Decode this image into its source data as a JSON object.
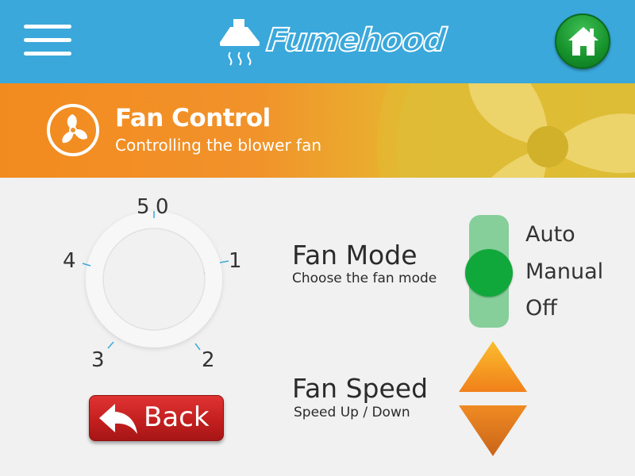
{
  "header": {
    "brand": "Fumehood",
    "menu_icon": "hamburger-menu-icon",
    "home_icon": "home-icon",
    "brand_icon": "fume-hood-icon"
  },
  "banner": {
    "title": "Fan Control",
    "subtitle": "Controlling the blower fan",
    "icon": "fan-icon"
  },
  "dial": {
    "labels": [
      "0",
      "1",
      "2",
      "3",
      "4",
      "5"
    ],
    "value": 0
  },
  "back_button": {
    "label": "Back",
    "icon": "back-arrow-icon"
  },
  "fan_mode": {
    "title": "Fan Mode",
    "subtitle": "Choose the fan mode",
    "options": [
      "Auto",
      "Manual",
      "Off"
    ],
    "selected": "Manual"
  },
  "fan_speed": {
    "title": "Fan Speed",
    "subtitle": "Speed Up / Down",
    "up_icon": "triangle-up-icon",
    "down_icon": "triangle-down-icon"
  },
  "colors": {
    "topbar": "#3aa8db",
    "banner_orange": "#f28b1f",
    "banner_yellow": "#d9b42b",
    "home_green": "#16922b",
    "back_red": "#c41f1f",
    "mode_green": "#11a83b",
    "mode_track": "#86cf9a",
    "arrow_orange": "#f59a1e"
  }
}
